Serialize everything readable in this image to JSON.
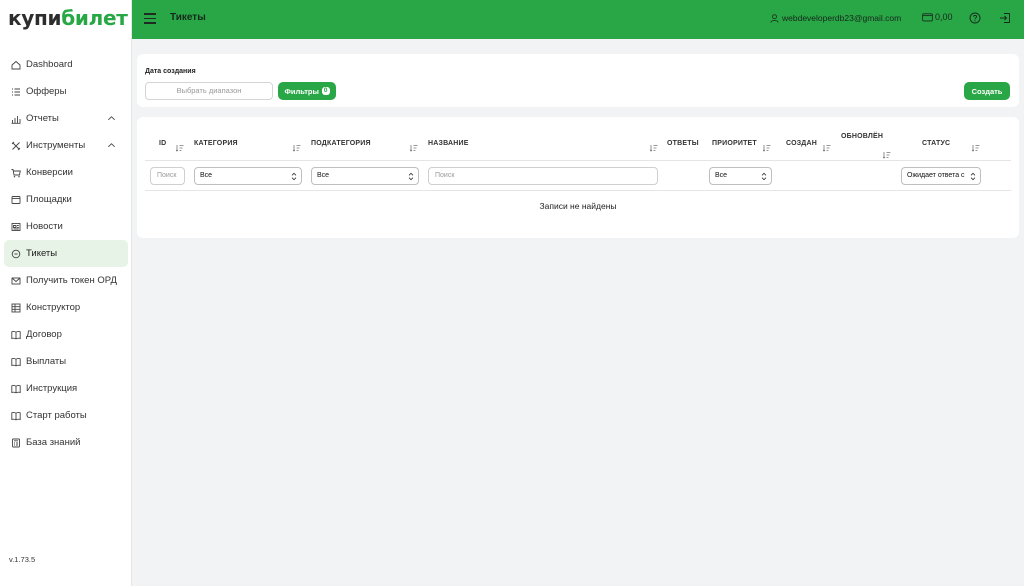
{
  "logo": {
    "part1": "купи",
    "part2": "билет"
  },
  "sidebar": {
    "items": [
      {
        "label": "Dashboard",
        "icon": "home-icon"
      },
      {
        "label": "Офферы",
        "icon": "list-icon"
      },
      {
        "label": "Отчеты",
        "icon": "chart-icon",
        "expandable": true
      },
      {
        "label": "Инструменты",
        "icon": "tools-icon",
        "expandable": true
      },
      {
        "label": "Конверсии",
        "icon": "cart-icon"
      },
      {
        "label": "Площадки",
        "icon": "window-icon"
      },
      {
        "label": "Новости",
        "icon": "newspaper-icon"
      },
      {
        "label": "Тикеты",
        "icon": "chat-icon",
        "active": true
      },
      {
        "label": "Получить токен ОРД",
        "icon": "mail-icon"
      },
      {
        "label": "Конструктор",
        "icon": "table-icon"
      },
      {
        "label": "Договор",
        "icon": "book-icon"
      },
      {
        "label": "Выплаты",
        "icon": "book-icon"
      },
      {
        "label": "Инструкция",
        "icon": "book-icon"
      },
      {
        "label": "Старт работы",
        "icon": "book-icon"
      },
      {
        "label": "База знаний",
        "icon": "calculator-icon"
      }
    ],
    "version": "v.1.73.5"
  },
  "header": {
    "title": "Тикеты",
    "user_email": "webdeveloperdb23@gmail.com",
    "balance": "0,00"
  },
  "filters": {
    "date_label": "Дата создания",
    "range_placeholder": "Выбрать диапазон",
    "filters_button": "Фильтры",
    "filters_count": "0",
    "create_button": "Создать"
  },
  "table": {
    "columns": {
      "id": "ID",
      "category": "КАТЕГОРИЯ",
      "subcategory": "ПОДКАТЕГОРИЯ",
      "name": "НАЗВАНИЕ",
      "answers": "ОТВЕТЫ",
      "priority": "ПРИОРИТЕТ",
      "created": "СОЗДАН",
      "updated": "ОБНОВЛЁН",
      "status": "СТАТУС"
    },
    "filters": {
      "id_placeholder": "Поиск",
      "category_value": "Все",
      "subcategory_value": "Все",
      "name_placeholder": "Поиск",
      "priority_value": "Все",
      "status_value": "Ожидает ответа с"
    },
    "empty_message": "Записи не найдены"
  },
  "colors": {
    "brand": "#29a646",
    "active_bg": "#e7f3e6"
  }
}
